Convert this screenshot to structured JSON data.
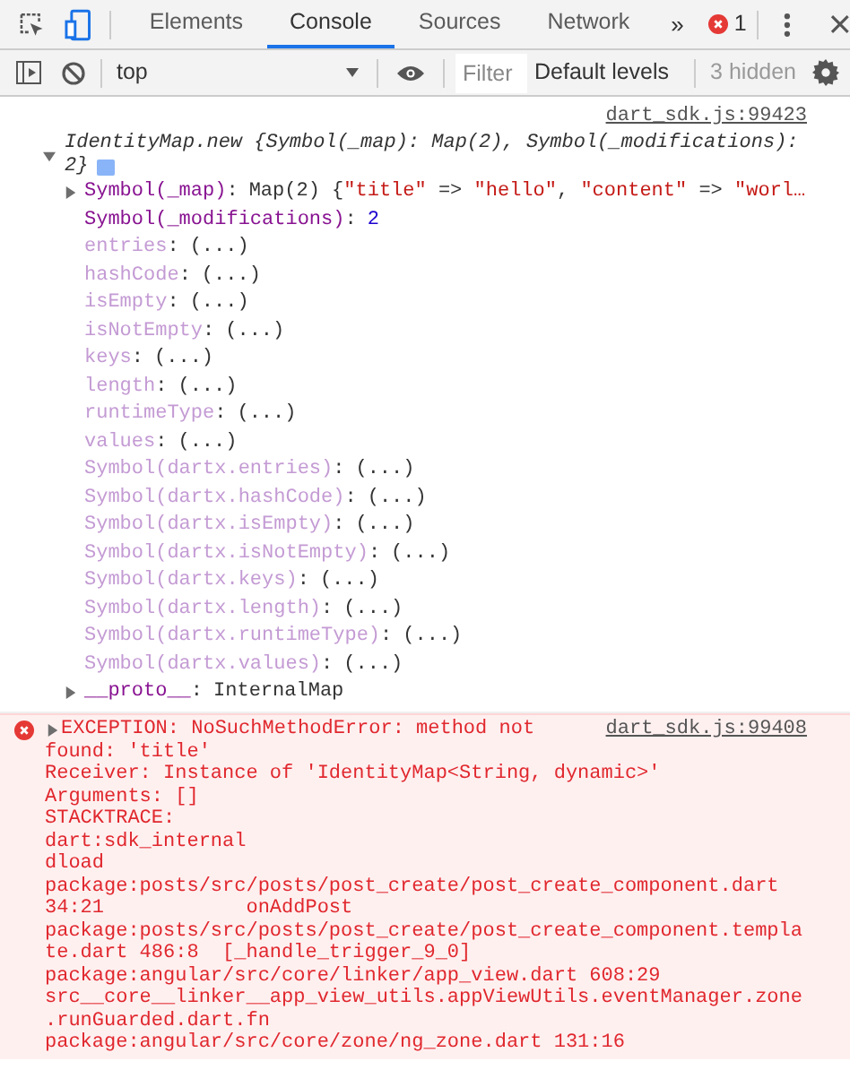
{
  "tabs": [
    {
      "label": "Elements",
      "selected": false
    },
    {
      "label": "Console",
      "selected": true
    },
    {
      "label": "Sources",
      "selected": false
    },
    {
      "label": "Network",
      "selected": false
    }
  ],
  "more_tabs": "»",
  "error_count": "1",
  "toolbar": {
    "context": "top",
    "filter_placeholder": "Filter",
    "levels": "Default levels",
    "hidden_count": "3 hidden"
  },
  "log": {
    "source": "dart_sdk.js:99423",
    "summary": "IdentityMap.new {Symbol(_map): Map(2), Symbol(_modifications): 2}",
    "expanded": true,
    "key_separator": ":",
    "properties": [
      {
        "kind": "own",
        "key": "Symbol(_map)",
        "expandable": true,
        "value": [
          {
            "kind": "plain",
            "text": "Map(2) {"
          },
          {
            "kind": "string",
            "text": "\"title\""
          },
          {
            "kind": "plain",
            "text": " => "
          },
          {
            "kind": "string",
            "text": "\"hello\""
          },
          {
            "kind": "plain",
            "text": ", "
          },
          {
            "kind": "string",
            "text": "\"content\""
          },
          {
            "kind": "plain",
            "text": " => "
          },
          {
            "kind": "string",
            "text": "\"worl…"
          }
        ]
      },
      {
        "kind": "own",
        "key": "Symbol(_modifications)",
        "expandable": false,
        "value": [
          {
            "kind": "number",
            "text": "2"
          }
        ]
      },
      {
        "kind": "getter",
        "key": "entries",
        "value": [
          {
            "kind": "plain",
            "text": "(...)"
          }
        ]
      },
      {
        "kind": "getter",
        "key": "hashCode",
        "value": [
          {
            "kind": "plain",
            "text": "(...)"
          }
        ]
      },
      {
        "kind": "getter",
        "key": "isEmpty",
        "value": [
          {
            "kind": "plain",
            "text": "(...)"
          }
        ]
      },
      {
        "kind": "getter",
        "key": "isNotEmpty",
        "value": [
          {
            "kind": "plain",
            "text": "(...)"
          }
        ]
      },
      {
        "kind": "getter",
        "key": "keys",
        "value": [
          {
            "kind": "plain",
            "text": "(...)"
          }
        ]
      },
      {
        "kind": "getter",
        "key": "length",
        "value": [
          {
            "kind": "plain",
            "text": "(...)"
          }
        ]
      },
      {
        "kind": "getter",
        "key": "runtimeType",
        "value": [
          {
            "kind": "plain",
            "text": "(...)"
          }
        ]
      },
      {
        "kind": "getter",
        "key": "values",
        "value": [
          {
            "kind": "plain",
            "text": "(...)"
          }
        ]
      },
      {
        "kind": "getter",
        "key": "Symbol(dartx.entries)",
        "value": [
          {
            "kind": "plain",
            "text": "(...)"
          }
        ]
      },
      {
        "kind": "getter",
        "key": "Symbol(dartx.hashCode)",
        "value": [
          {
            "kind": "plain",
            "text": "(...)"
          }
        ]
      },
      {
        "kind": "getter",
        "key": "Symbol(dartx.isEmpty)",
        "value": [
          {
            "kind": "plain",
            "text": "(...)"
          }
        ]
      },
      {
        "kind": "getter",
        "key": "Symbol(dartx.isNotEmpty)",
        "value": [
          {
            "kind": "plain",
            "text": "(...)"
          }
        ]
      },
      {
        "kind": "getter",
        "key": "Symbol(dartx.keys)",
        "value": [
          {
            "kind": "plain",
            "text": "(...)"
          }
        ]
      },
      {
        "kind": "getter",
        "key": "Symbol(dartx.length)",
        "value": [
          {
            "kind": "plain",
            "text": "(...)"
          }
        ]
      },
      {
        "kind": "getter",
        "key": "Symbol(dartx.runtimeType)",
        "value": [
          {
            "kind": "plain",
            "text": "(...)"
          }
        ]
      },
      {
        "kind": "getter",
        "key": "Symbol(dartx.values)",
        "value": [
          {
            "kind": "plain",
            "text": "(...)"
          }
        ]
      },
      {
        "kind": "own",
        "key": "__proto__",
        "expandable": true,
        "value": [
          {
            "kind": "plain",
            "text": "InternalMap"
          }
        ]
      }
    ]
  },
  "error": {
    "source": "dart_sdk.js:99408",
    "expanded": false,
    "lines": [
      "EXCEPTION: NoSuchMethodError: method not",
      "found: 'title'",
      "Receiver: Instance of 'IdentityMap<String, dynamic>'",
      "Arguments: []",
      "STACKTRACE:",
      "dart:sdk_internal",
      "dload",
      "package:posts/src/posts/post_create/post_create_component.dart",
      "34:21            onAddPost",
      "package:posts/src/posts/post_create/post_create_component.templa",
      "te.dart 486:8  [_handle_trigger_9_0]",
      "package:angular/src/core/linker/app_view.dart 608:29",
      "src__core__linker__app_view_utils.appViewUtils.eventManager.zone",
      ".runGuarded.dart.fn",
      "package:angular/src/core/zone/ng_zone.dart 131:16"
    ]
  }
}
